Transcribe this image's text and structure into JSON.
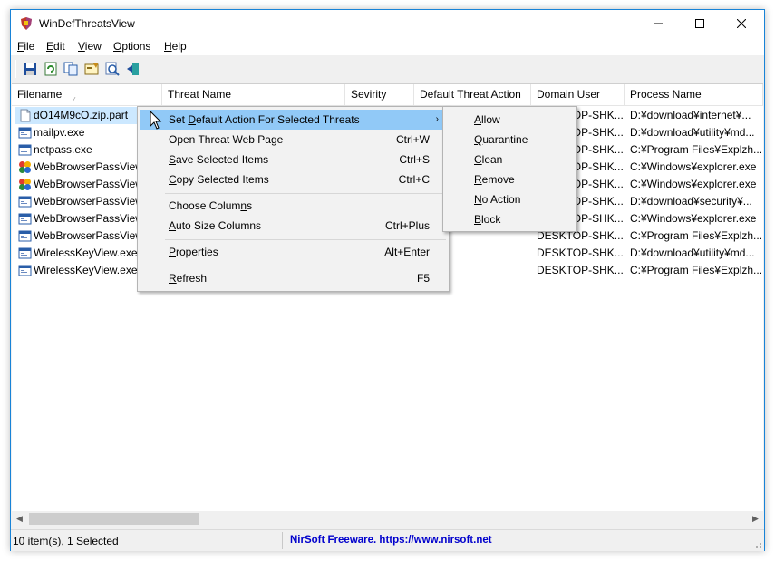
{
  "window": {
    "title": "WinDefThreatsView"
  },
  "menubar": [
    {
      "label": "File",
      "u": "F",
      "rest": "ile"
    },
    {
      "label": "Edit",
      "u": "E",
      "rest": "dit"
    },
    {
      "label": "View",
      "u": "V",
      "rest": "iew"
    },
    {
      "label": "Options",
      "u": "O",
      "rest": "ptions"
    },
    {
      "label": "Help",
      "u": "H",
      "rest": "elp"
    }
  ],
  "columns": [
    "Filename",
    "Threat Name",
    "Sevirity",
    "Default Threat Action",
    "Domain User",
    "Process Name"
  ],
  "rows": [
    {
      "filename": "dO14M9cO.zip.part",
      "icon": "blank-file-icon",
      "domain": "DESKTOP-SHK...",
      "process": "D:¥download¥internet¥..."
    },
    {
      "filename": "mailpv.exe",
      "icon": "app-window-icon",
      "domain": "DESKTOP-SHK...",
      "process": "D:¥download¥utility¥md..."
    },
    {
      "filename": "netpass.exe",
      "icon": "app-window-icon",
      "domain": "DESKTOP-SHK...",
      "process": "C:¥Program Files¥Explzh..."
    },
    {
      "filename": "WebBrowserPassView.",
      "icon": "color-app-icon",
      "domain": "DESKTOP-SHK...",
      "process": "C:¥Windows¥explorer.exe"
    },
    {
      "filename": "WebBrowserPassView.",
      "icon": "color-app-icon",
      "domain": "DESKTOP-SHK...",
      "process": "C:¥Windows¥explorer.exe"
    },
    {
      "filename": "WebBrowserPassView.",
      "icon": "app-window-icon",
      "domain": "DESKTOP-SHK...",
      "process": "D:¥download¥security¥..."
    },
    {
      "filename": "WebBrowserPassView.",
      "icon": "app-window-icon",
      "domain": "DESKTOP-SHK...",
      "process": "C:¥Windows¥explorer.exe"
    },
    {
      "filename": "WebBrowserPassView.",
      "icon": "app-window-icon",
      "domain": "DESKTOP-SHK...",
      "process": "C:¥Program Files¥Explzh..."
    },
    {
      "filename": "WirelessKeyView.exe",
      "icon": "app-window-icon",
      "domain": "DESKTOP-SHK...",
      "process": "D:¥download¥utility¥md..."
    },
    {
      "filename": "WirelessKeyView.exe",
      "icon": "app-window-icon",
      "domain": "DESKTOP-SHK...",
      "process": "C:¥Program Files¥Explzh..."
    }
  ],
  "context_menu": {
    "items": [
      {
        "pre": "Set ",
        "u": "D",
        "post": "efault Action For Selected Threats",
        "shortcut": "",
        "submenu": true
      },
      {
        "pre": "Open Threat Web Page",
        "u": "",
        "post": "",
        "shortcut": "Ctrl+W"
      },
      {
        "pre": "",
        "u": "S",
        "post": "ave Selected Items",
        "shortcut": "Ctrl+S"
      },
      {
        "pre": "",
        "u": "C",
        "post": "opy Selected Items",
        "shortcut": "Ctrl+C"
      },
      {
        "pre": "Choose Colum",
        "u": "n",
        "post": "s",
        "shortcut": ""
      },
      {
        "pre": "",
        "u": "A",
        "post": "uto Size Columns",
        "shortcut": "Ctrl+Plus"
      },
      {
        "pre": "",
        "u": "P",
        "post": "roperties",
        "shortcut": "Alt+Enter"
      },
      {
        "pre": "",
        "u": "R",
        "post": "efresh",
        "shortcut": "F5"
      }
    ]
  },
  "submenu": {
    "items": [
      {
        "u": "A",
        "post": "llow"
      },
      {
        "u": "Q",
        "post": "uarantine"
      },
      {
        "u": "C",
        "post": "lean"
      },
      {
        "u": "R",
        "post": "emove"
      },
      {
        "u": "N",
        "post": "o Action"
      },
      {
        "u": "B",
        "post": "lock"
      }
    ]
  },
  "status": {
    "count": "10 item(s), 1 Selected",
    "link": "NirSoft Freeware. https://www.nirsoft.net"
  },
  "colors": {
    "selection": "#cce8ff",
    "menu_highlight": "#91c9f7",
    "window_border": "#1883d7",
    "link": "#0000cc"
  }
}
